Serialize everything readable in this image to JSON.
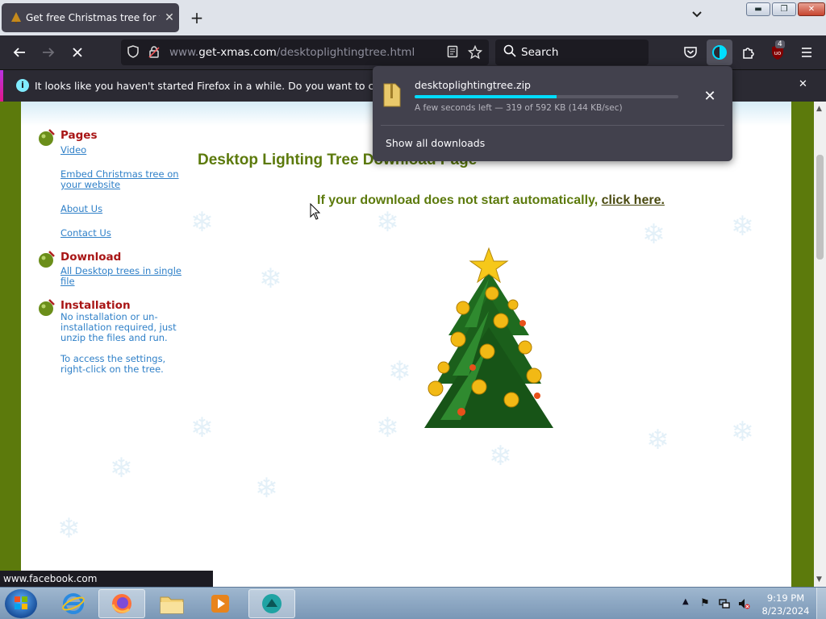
{
  "browser": {
    "tab_title": "Get free Christmas tree for your",
    "url_prefix": "www.",
    "url_domain": "get-xmas.com",
    "url_path": "/desktoplightingtree.html",
    "search_placeholder": "Search",
    "extension_badge": "4"
  },
  "notification": {
    "text": "It looks like you haven't started Firefox in a while. Do you want to clean it up for"
  },
  "downloads": {
    "filename": "desktoplightingtree.zip",
    "progress_fraction": 0.539,
    "status": "A few seconds left — 319 of 592 KB (144 KB/sec)",
    "show_all": "Show all downloads"
  },
  "page": {
    "heading": "Desktop Lighting Tree Download Page",
    "download_msg": "If your download does not start automatically, ",
    "download_link": "click here.",
    "sidebar": {
      "pages_title": "Pages",
      "pages_links": [
        "Video",
        "Embed Christmas tree on your website",
        "About Us",
        "Contact Us"
      ],
      "download_title": "Download",
      "download_link": "All Desktop trees in single file",
      "install_title": "Installation",
      "install_text_1": "No installation or un-installation required, just unzip the files and run.",
      "install_text_2": "To access the settings, right-click on the tree."
    },
    "status_url": "www.facebook.com"
  },
  "taskbar": {
    "time": "9:19 PM",
    "date": "8/23/2024"
  },
  "colors": {
    "accent_cyan": "#00ddff",
    "heading_green": "#5c7a0c",
    "section_red": "#a81515",
    "link_blue": "#2f80c8"
  }
}
